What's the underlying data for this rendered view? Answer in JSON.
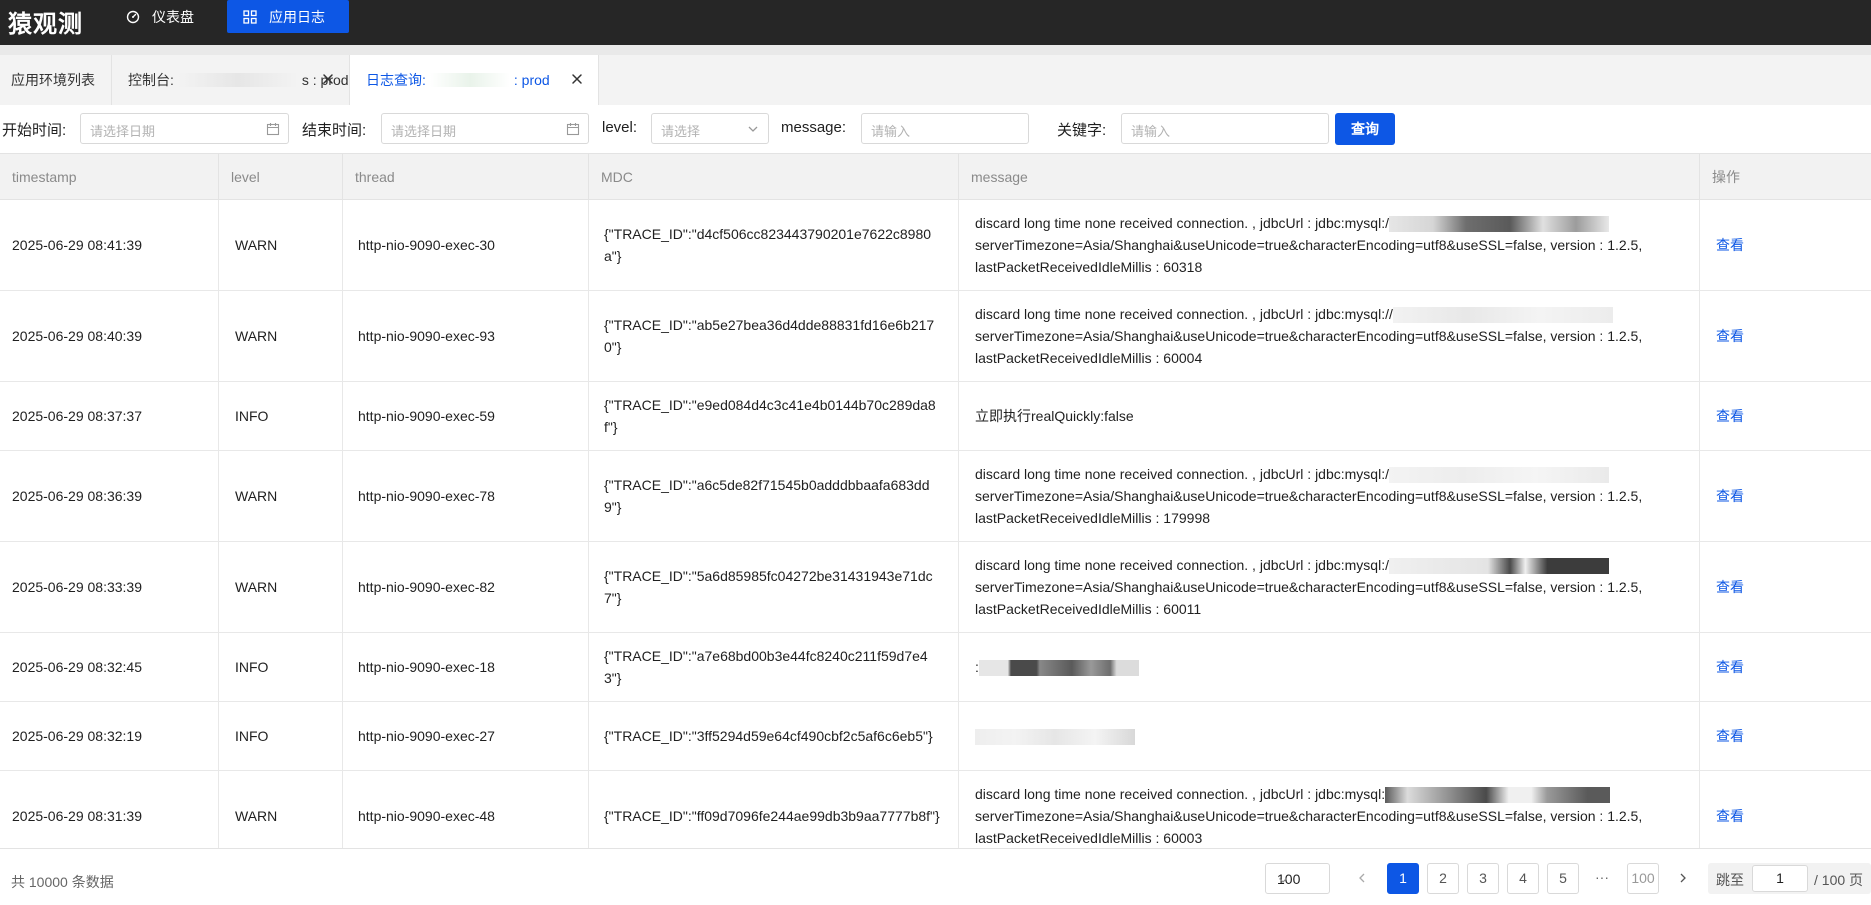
{
  "app": {
    "title": "猿观测"
  },
  "nav": [
    {
      "label": "仪表盘",
      "icon": "gauge-icon"
    },
    {
      "label": "应用日志",
      "icon": "grid-icon",
      "active": true
    }
  ],
  "tabs": [
    {
      "label": "应用环境列表"
    },
    {
      "label_prefix": "控制台:",
      "label_suffix": "s : prod",
      "closable": true
    },
    {
      "label_prefix": "日志查询:",
      "label_suffix": ": prod",
      "closable": true,
      "active": true
    }
  ],
  "filters": {
    "start_label": "开始时间:",
    "start_placeholder": "请选择日期",
    "end_label": "结束时间:",
    "end_placeholder": "请选择日期",
    "level_label": "level:",
    "level_placeholder": "请选择",
    "message_label": "message:",
    "message_placeholder": "请输入",
    "keyword_label": "关键字:",
    "keyword_placeholder": "请输入",
    "query_button": "查询"
  },
  "table": {
    "columns": [
      "timestamp",
      "level",
      "thread",
      "MDC",
      "message",
      "操作"
    ],
    "rows": [
      {
        "timestamp": "2025-06-29 08:41:39",
        "level": "WARN",
        "thread": "http-nio-9090-exec-30",
        "mdc": "{\"TRACE_ID\":\"d4cf506cc823443790201e7622c8980a\"}",
        "message_before": "discard long time none received connection. , jdbcUrl : jdbc:mysql:/",
        "message_after": "serverTimezone=Asia/Shanghai&useUnicode=true&characterEncoding=utf8&useSSL=false, version : 1.2.5, lastPacketReceivedIdleMillis : 60318",
        "action": "查看"
      },
      {
        "timestamp": "2025-06-29 08:40:39",
        "level": "WARN",
        "thread": "http-nio-9090-exec-93",
        "mdc": "{\"TRACE_ID\":\"ab5e27bea36d4dde88831fd16e6b2170\"}",
        "message_before": "discard long time none received connection. , jdbcUrl : jdbc:mysql://",
        "message_after": "serverTimezone=Asia/Shanghai&useUnicode=true&characterEncoding=utf8&useSSL=false, version : 1.2.5, lastPacketReceivedIdleMillis : 60004",
        "action": "查看"
      },
      {
        "timestamp": "2025-06-29 08:37:37",
        "level": "INFO",
        "thread": "http-nio-9090-exec-59",
        "mdc": "{\"TRACE_ID\":\"e9ed084d4c3c41e4b0144b70c289da8f\"}",
        "message_before": "立即执行realQuickly:false",
        "message_after": "",
        "action": "查看"
      },
      {
        "timestamp": "2025-06-29 08:36:39",
        "level": "WARN",
        "thread": "http-nio-9090-exec-78",
        "mdc": "{\"TRACE_ID\":\"a6c5de82f71545b0adddbbaafa683dd9\"}",
        "message_before": "discard long time none received connection. , jdbcUrl : jdbc:mysql:/",
        "message_after": "serverTimezone=Asia/Shanghai&useUnicode=true&characterEncoding=utf8&useSSL=false, version : 1.2.5, lastPacketReceivedIdleMillis : 179998",
        "action": "查看"
      },
      {
        "timestamp": "2025-06-29 08:33:39",
        "level": "WARN",
        "thread": "http-nio-9090-exec-82",
        "mdc": "{\"TRACE_ID\":\"5a6d85985fc04272be31431943e71dc7\"}",
        "message_before": "discard long time none received connection. , jdbcUrl : jdbc:mysql:/",
        "message_after": "serverTimezone=Asia/Shanghai&useUnicode=true&characterEncoding=utf8&useSSL=false, version : 1.2.5, lastPacketReceivedIdleMillis : 60011",
        "action": "查看"
      },
      {
        "timestamp": "2025-06-29 08:32:45",
        "level": "INFO",
        "thread": "http-nio-9090-exec-18",
        "mdc": "{\"TRACE_ID\":\"a7e68bd00b3e44fc8240c211f59d7e43\"}",
        "message_before": ":",
        "message_after": "",
        "action": "查看"
      },
      {
        "timestamp": "2025-06-29 08:32:19",
        "level": "INFO",
        "thread": "http-nio-9090-exec-27",
        "mdc": "{\"TRACE_ID\":\"3ff5294d59e64cf490cbf2c5af6c6eb5\"}",
        "message_before": "",
        "message_after": "",
        "action": "查看"
      },
      {
        "timestamp": "2025-06-29 08:31:39",
        "level": "WARN",
        "thread": "http-nio-9090-exec-48",
        "mdc": "{\"TRACE_ID\":\"ff09d7096fe244ae99db3b9aa7777b8f\"}",
        "message_before": "discard long time none received connection. , jdbcUrl : jdbc:mysql:",
        "message_after": "serverTimezone=Asia/Shanghai&useUnicode=true&characterEncoding=utf8&useSSL=false, version : 1.2.5, lastPacketReceivedIdleMillis : 60003",
        "action": "查看"
      }
    ]
  },
  "pagination": {
    "total_text": "共 10000 条数据",
    "page_size": "100",
    "pages": [
      "1",
      "2",
      "3",
      "4",
      "5"
    ],
    "ellipsis": "···",
    "last_page": "100",
    "current_page": "1",
    "jump_label": "跳至",
    "jump_value": "1",
    "jump_total": "/ 100 页"
  },
  "colors": {
    "accent": "#0d57e5",
    "topbar": "#262626"
  }
}
